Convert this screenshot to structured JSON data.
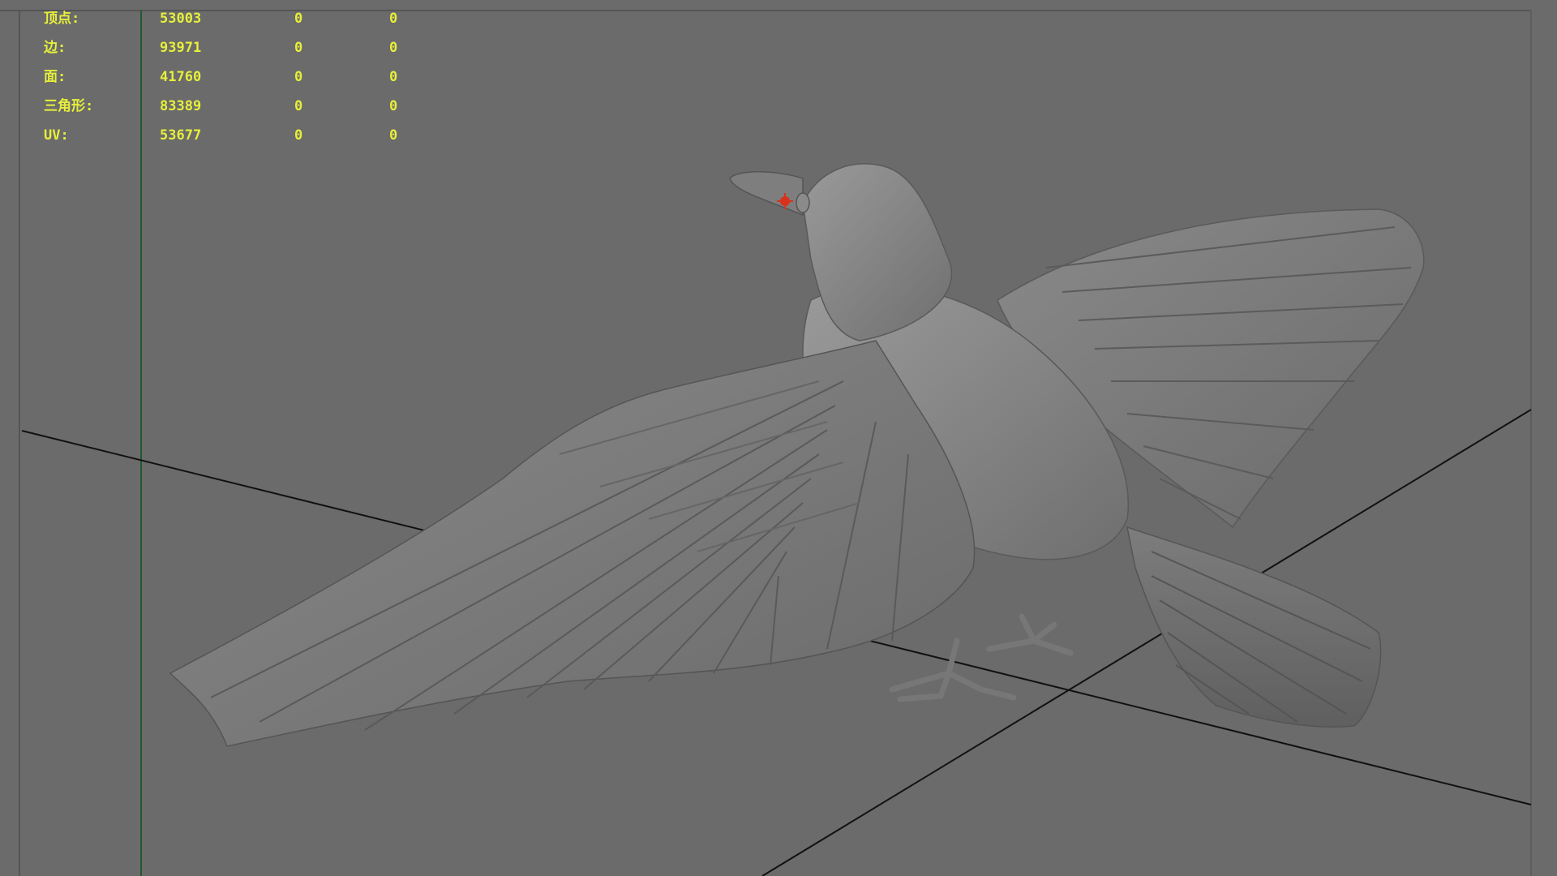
{
  "viewport": {
    "background_color": "#6b6b6b",
    "grid_line_color": "#111111",
    "vertical_axis_color": "#1f5a2c",
    "hud_text_color": "#e6ef3a",
    "manipulator_color": "#d8321c",
    "model_description": "raven-model-wings-spread"
  },
  "hud": {
    "rows": [
      {
        "label": "顶点:",
        "v1": "53003",
        "v2": "0",
        "v3": "0"
      },
      {
        "label": "边:",
        "v1": "93971",
        "v2": "0",
        "v3": "0"
      },
      {
        "label": "面:",
        "v1": "41760",
        "v2": "0",
        "v3": "0"
      },
      {
        "label": "三角形:",
        "v1": "83389",
        "v2": "0",
        "v3": "0"
      },
      {
        "label": "UV:",
        "v1": "53677",
        "v2": "0",
        "v3": "0"
      }
    ]
  }
}
